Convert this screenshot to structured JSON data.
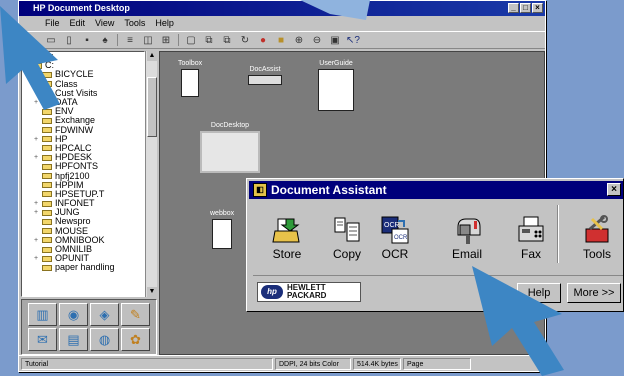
{
  "main_window": {
    "title": "HP Document Desktop",
    "menu": [
      "File",
      "Edit",
      "View",
      "Tools",
      "Help"
    ],
    "tree_items": [
      {
        "label": "A:",
        "expand": ""
      },
      {
        "label": "C:",
        "expand": "-"
      },
      {
        "label": "BICYCLE",
        "expand": ""
      },
      {
        "label": "Class",
        "expand": ""
      },
      {
        "label": "Cust Visits",
        "expand": ""
      },
      {
        "label": "DATA",
        "expand": "+"
      },
      {
        "label": "ENV",
        "expand": ""
      },
      {
        "label": "Exchange",
        "expand": ""
      },
      {
        "label": "FDWINW",
        "expand": ""
      },
      {
        "label": "HP",
        "expand": "+"
      },
      {
        "label": "HPCALC",
        "expand": ""
      },
      {
        "label": "HPDESK",
        "expand": "+"
      },
      {
        "label": "HPFONTS",
        "expand": ""
      },
      {
        "label": "hpfj2100",
        "expand": ""
      },
      {
        "label": "HPPIM",
        "expand": ""
      },
      {
        "label": "HPSETUP.T",
        "expand": ""
      },
      {
        "label": "INFONET",
        "expand": "+"
      },
      {
        "label": "JUNG",
        "expand": "+"
      },
      {
        "label": "Newspro",
        "expand": ""
      },
      {
        "label": "MOUSE",
        "expand": ""
      },
      {
        "label": "OMNIBOOK",
        "expand": "+"
      },
      {
        "label": "OMNILIB",
        "expand": ""
      },
      {
        "label": "OPUNIT",
        "expand": "+"
      },
      {
        "label": "paper handling",
        "expand": ""
      }
    ],
    "thumbnails": [
      {
        "label": "Toolbox"
      },
      {
        "label": "DocAssist"
      },
      {
        "label": "UserGuide"
      },
      {
        "label": "DocDesktop"
      },
      {
        "label": "webbox"
      }
    ],
    "status": {
      "left": "Tutorial",
      "color": "DDPI, 24 bits Color",
      "size": "514.4K bytes",
      "page": "Page"
    }
  },
  "doc_assistant": {
    "title": "Document Assistant",
    "close": "×",
    "tools": [
      {
        "label": "Store",
        "icon": "store-icon"
      },
      {
        "label": "Copy",
        "icon": "copy-icon"
      },
      {
        "label": "OCR",
        "icon": "ocr-icon"
      },
      {
        "label": "Email",
        "icon": "mailbox-icon"
      },
      {
        "label": "Fax",
        "icon": "fax-icon"
      },
      {
        "label": "Tools",
        "icon": "tools-icon"
      }
    ],
    "logo": {
      "badge": "hp",
      "line1": "HEWLETT",
      "line2": "PACKARD"
    },
    "help_button": "Help",
    "more_button": "More >>"
  },
  "colors": {
    "background": "#7b9bcc",
    "title_bar": "#00007b",
    "arrow": "#3d86c4"
  }
}
